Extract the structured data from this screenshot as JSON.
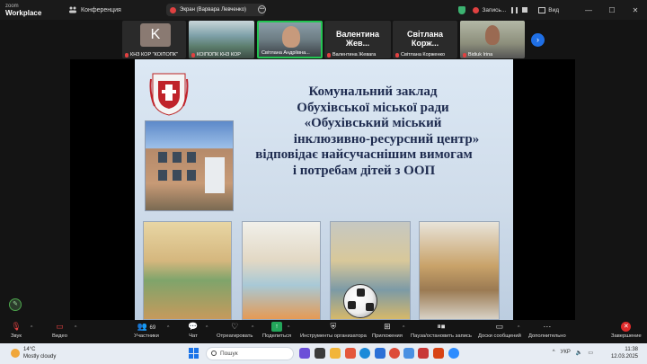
{
  "window": {
    "logo_top": "zoom",
    "logo_bottom": "Workplace",
    "conference_label": "Конференция",
    "screen_share_label": "Экран (Варвара Левченко)",
    "recording_label": "Запись...",
    "view_label": "Вид"
  },
  "participants": [
    {
      "name": "КНЗ КОР \"КОІПОПК\"",
      "avatar_letter": "K"
    },
    {
      "name": "КОІПОПК КНЗ КОР"
    },
    {
      "name": "Світлана Андріївна..."
    },
    {
      "name": "Валентина Жевага",
      "tile_text": "Валентина Жев..."
    },
    {
      "name": "Світлана Корженко",
      "tile_text": "Світлана Корж..."
    },
    {
      "name": "Bidiuk Irina"
    }
  ],
  "slide": {
    "lines": [
      "Комунальний заклад",
      "Обухівської міської ради",
      "«Обухівський міський",
      "інклюзивно-ресурсний центр»",
      "відповідає  найсучаснішим вимогам",
      "і потребам дітей з ООП"
    ]
  },
  "controls": {
    "audio": "Звук",
    "video": "Видео",
    "participants": "Участники",
    "participants_count": "69",
    "chat": "Чат",
    "react": "Отреагировать",
    "share": "Поделиться",
    "host_tools": "Инструменты организатора",
    "apps": "Приложения",
    "pause_record": "Пауза/остановить запись",
    "boards": "Доски сообщений",
    "more": "Дополнительно",
    "end": "Завершение"
  },
  "taskbar": {
    "temperature": "14°C",
    "weather": "Mostly cloudy",
    "search_placeholder": "Пошук",
    "language": "УКР",
    "time": "11:38",
    "date": "12.03.2025"
  },
  "colors": {
    "accent_blue": "#1f6fe5",
    "share_green": "#23a55a",
    "end_red": "#e02a2a",
    "slide_text": "#1e2b4f"
  }
}
